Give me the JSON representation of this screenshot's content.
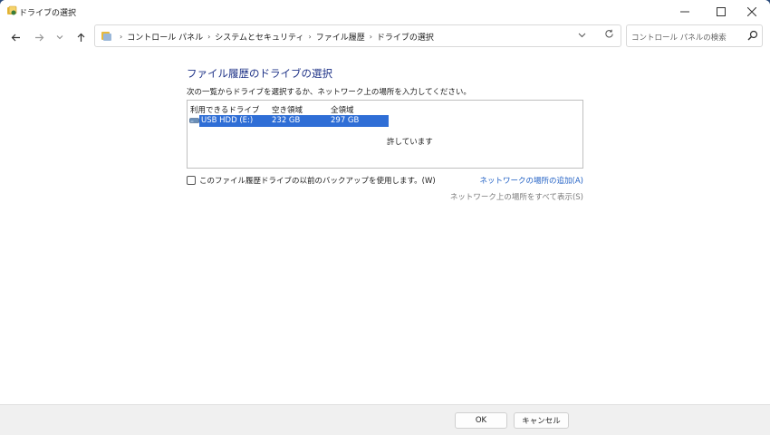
{
  "window": {
    "title": "ドライブの選択",
    "minimize_icon": "minimize-icon",
    "maximize_icon": "maximize-icon",
    "close_icon": "close-icon"
  },
  "nav": {
    "breadcrumbs": [
      "コントロール パネル",
      "システムとセキュリティ",
      "ファイル履歴",
      "ドライブの選択"
    ],
    "search_placeholder": "コントロール パネルの検索"
  },
  "main": {
    "heading": "ファイル履歴のドライブの選択",
    "instruction": "次の一覧からドライブを選択するか、ネットワーク上の場所を入力してください。",
    "columns": [
      "利用できるドライブ",
      "空き領域",
      "全領域"
    ],
    "drives": [
      {
        "name": "USB HDD (E:)",
        "free": "232 GB",
        "total": "297 GB",
        "selected": true
      }
    ],
    "status_text": "許しています",
    "checkbox_label": "このファイル履歴ドライブの以前のバックアップを使用します。(W)",
    "checkbox_checked": false,
    "link_add_network": "ネットワークの場所の追加(A)",
    "link_show_all_network": "ネットワーク上の場所をすべて表示(S)"
  },
  "footer": {
    "ok_label": "OK",
    "cancel_label": "キャンセル"
  },
  "colors": {
    "heading": "#1e3287",
    "selection": "#2f6ed6",
    "link": "#1f5fc4"
  }
}
